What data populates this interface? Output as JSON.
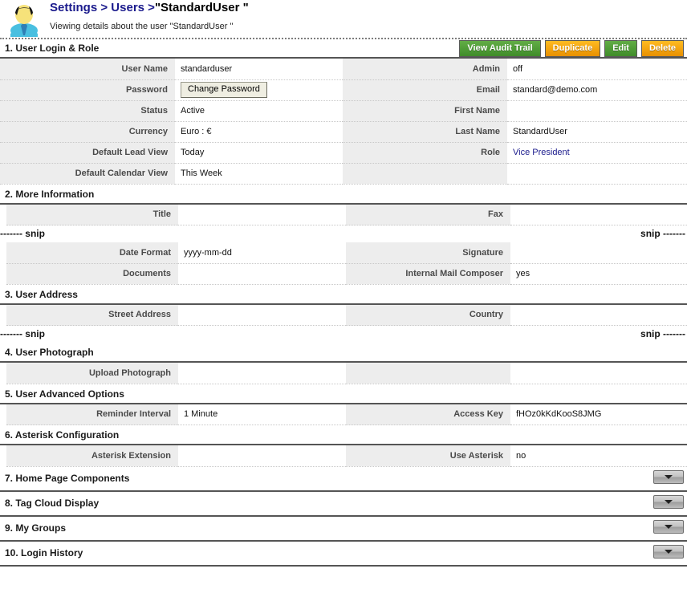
{
  "header": {
    "avatar_icon": "user-avatar-icon",
    "breadcrumb": {
      "root": "Settings",
      "sep1": ">",
      "parent": "Users",
      "sep2": ">",
      "current": "\"StandardUser \""
    },
    "subtitle": "Viewing details about the user \"StandardUser \""
  },
  "toolbar": {
    "buttons": [
      {
        "label": "View Audit Trail",
        "color": "#4b9a33",
        "style": "green"
      },
      {
        "label": "Duplicate",
        "color": "#f5a200",
        "style": "orange"
      },
      {
        "label": "Edit",
        "color": "#4b9a33",
        "style": "green"
      },
      {
        "label": "Delete",
        "color": "#f5a200",
        "style": "orange"
      }
    ]
  },
  "snip": {
    "left": "------- snip",
    "right": "snip -------"
  },
  "sections": [
    {
      "title": "1. User Login & Role",
      "rows": [
        {
          "label_l": "User Name",
          "value_l": "standarduser",
          "label_r": "Admin",
          "value_r": "off"
        },
        {
          "label_l": "Password",
          "value_l": "",
          "label_r": "Email",
          "value_r": "standard@demo.com",
          "value_l_button": "Change Password"
        },
        {
          "label_l": "Status",
          "value_l": "Active",
          "label_r": "First Name",
          "value_r": ""
        },
        {
          "label_l": "Currency",
          "value_l": "Euro : €",
          "label_r": "Last Name",
          "value_r": "StandardUser"
        },
        {
          "label_l": "Default Lead View",
          "value_l": "Today",
          "label_r": "Role",
          "value_r": "Vice President",
          "value_r_link": true
        },
        {
          "label_l": "Default Calendar View",
          "value_l": "This Week",
          "label_r": "",
          "value_r": ""
        }
      ]
    },
    {
      "title": "2. More Information",
      "rows_top": [
        {
          "label_l": "Title",
          "value_l": "",
          "label_r": "Fax",
          "value_r": ""
        }
      ],
      "has_snip": true,
      "rows_bottom": [
        {
          "label_l": "Date Format",
          "value_l": "yyyy-mm-dd",
          "label_r": "Signature",
          "value_r": ""
        },
        {
          "label_l": "Documents",
          "value_l": "",
          "label_r": "Internal Mail Composer",
          "value_r": "yes"
        }
      ]
    },
    {
      "title": "3. User Address",
      "rows_top": [
        {
          "label_l": "Street Address",
          "value_l": "",
          "label_r": "Country",
          "value_r": ""
        }
      ],
      "has_snip": true,
      "rows_bottom": []
    },
    {
      "title": "4. User Photograph",
      "rows_top": [
        {
          "label_l": "Upload Photograph",
          "value_l": "",
          "label_r": "",
          "value_r": ""
        }
      ],
      "has_snip": false,
      "rows_bottom": []
    },
    {
      "title": "5. User Advanced Options",
      "rows_top": [
        {
          "label_l": "Reminder Interval",
          "value_l": "1 Minute",
          "label_r": "Access Key",
          "value_r": "fHOz0kKdKooS8JMG"
        }
      ],
      "has_snip": false,
      "rows_bottom": []
    },
    {
      "title": "6. Asterisk Configuration",
      "rows_top": [
        {
          "label_l": "Asterisk Extension",
          "value_l": "",
          "label_r": "Use Asterisk",
          "value_r": "no"
        }
      ],
      "has_snip": false,
      "rows_bottom": []
    }
  ],
  "collapsed_sections": [
    {
      "title": "7. Home Page Components",
      "toggle_icon": "chevron-down-icon"
    },
    {
      "title": "8. Tag Cloud Display",
      "toggle_icon": "chevron-down-icon"
    },
    {
      "title": "9. My Groups",
      "toggle_icon": "chevron-down-icon"
    },
    {
      "title": "10. Login History",
      "toggle_icon": "chevron-down-icon"
    }
  ]
}
